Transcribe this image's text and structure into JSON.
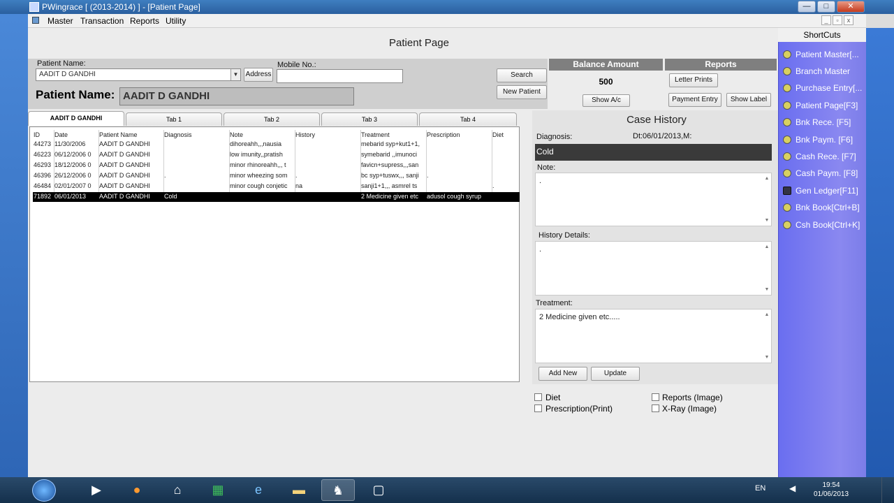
{
  "window": {
    "title": "PWingrace    [ (2013-2014) ] - [Patient Page]",
    "min": "—",
    "max": "□",
    "close": "✕"
  },
  "menu": {
    "items": [
      "Master",
      "Transaction",
      "Reports",
      "Utility"
    ],
    "mdi": [
      "_",
      "▫",
      "x"
    ]
  },
  "page_title": "Patient Page",
  "search_panel": {
    "patient_name_label": "Patient Name:",
    "patient_combo_value": "AADIT D GANDHI",
    "address_button": "Address",
    "mobile_label": "Mobile No.:",
    "mobile_value": "",
    "search_button": "Search",
    "new_patient_button": "New Patient",
    "big_label": "Patient Name:",
    "big_value": "AADIT D GANDHI"
  },
  "balance": {
    "header": "Balance Amount",
    "amount": "500",
    "show_button": "Show A/c"
  },
  "reports": {
    "header": "Reports",
    "letter_prints": "Letter Prints",
    "payment_entry": "Payment Entry",
    "show_label": "Show Label"
  },
  "tabs": [
    "AADIT D GANDHI",
    "Tab 1",
    "Tab 2",
    "Tab 3",
    "Tab 4"
  ],
  "grid": {
    "columns": [
      "ID",
      "Date",
      "Patient Name",
      "Diagnosis",
      "Note",
      "History",
      "Treatment",
      "Prescription",
      "Diet"
    ],
    "rows": [
      [
        "44273",
        "11/30/2006",
        "AADIT D GANDHI",
        "",
        "dihoreahh,,,nausia",
        "",
        "mebarid syp+kut1+1,",
        "",
        ""
      ],
      [
        "46223",
        "06/12/2006 0",
        "AADIT D GANDHI",
        "",
        "low imunity,,pratish",
        "",
        "symebarid ,,imunoci",
        "",
        ""
      ],
      [
        "46293",
        "18/12/2006 0",
        "AADIT D GANDHI",
        "",
        "minor rhinoreahh,,, t",
        "",
        "favicn+supress,,,san",
        "",
        ""
      ],
      [
        "46396",
        "26/12/2006 0",
        "AADIT D GANDHI",
        ".",
        "minor wheezing som",
        ".",
        "bc syp+tuswx,,, sanji",
        ".",
        ""
      ],
      [
        "46484",
        "02/01/2007 0",
        "AADIT D GANDHI",
        "",
        "minor cough conjetic",
        "na",
        "sanji1+1,,, asmrel ts",
        "",
        "."
      ],
      [
        "71892",
        "06/01/2013",
        "AADIT D GANDHI",
        "Cold",
        "",
        "",
        "2 Medicine given etc",
        "adusol cough syrup",
        ""
      ]
    ]
  },
  "case_history": {
    "title": "Case History",
    "diagnosis_label": "Diagnosis:",
    "diagnosis_meta": "Dt:06/01/2013,M:",
    "diagnosis_value": "Cold",
    "note_label": "Note:",
    "note_value": ".",
    "history_label": "History Details:",
    "history_value": ".",
    "treatment_label": "Treatment:",
    "treatment_value": "2 Medicine given etc.....",
    "add_new": "Add New",
    "update": "Update"
  },
  "checkboxes": {
    "diet": "Diet",
    "prescription": "Prescription(Print)",
    "reports_image": "Reports (Image)",
    "xray_image": "X-Ray (Image)"
  },
  "shortcuts": {
    "header": "ShortCuts",
    "items": [
      "Patient Master[...",
      "Branch Master",
      "Purchase Entry[...",
      "Patient Page[F3]",
      "Bnk Rece.   [F5]",
      "Bnk Paym.   [F6]",
      "Cash Rece.  [F7]",
      "Cash Paym.  [F8]",
      "Gen Ledger[F11]",
      "Bnk Book[Ctrl+B]",
      "Csh Book[Ctrl+K]"
    ]
  },
  "taskbar": {
    "lang": "EN",
    "time": "19:54",
    "date": "01/06/2013"
  }
}
